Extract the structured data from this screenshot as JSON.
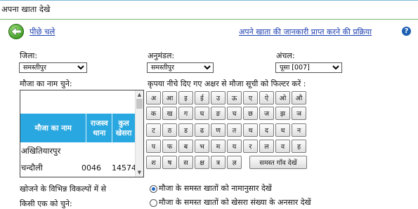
{
  "page": {
    "title": "अपना खाता देखे"
  },
  "nav": {
    "back_label": "पीछे चले",
    "process_link": "अपने खाता की जानकारी प्राप्त करने की प्रक्रिया",
    "help_icon": "help-icon"
  },
  "filters": {
    "district": {
      "label": "जिला:",
      "value": "समस्तीपुर"
    },
    "subdivision": {
      "label": "अनुमंडल:",
      "value": "समस्तीपुर"
    },
    "circle": {
      "label": "अंचल:",
      "value": "पूसा [007]"
    }
  },
  "mauza": {
    "label": "मौजा का नाम चुने:",
    "columns": [
      "मौजा का नाम",
      "राजस्व थाना",
      "कुल खेसरा"
    ],
    "rows": [
      {
        "name": "अखितियारपुर",
        "thana": "",
        "khesra": ""
      },
      {
        "name": "चन्दौली",
        "thana": "0046",
        "khesra": "14574"
      }
    ]
  },
  "keyboard": {
    "label": "कृपया नीचे दिए गए अक्षर से मौजा सूची को फिल्टर करें :",
    "rows": [
      [
        "अ",
        "आ",
        "इ",
        "ई",
        "उ",
        "ऊ",
        "ए",
        "ऐ",
        "ओ",
        "औ"
      ],
      [
        "क",
        "ख",
        "ग",
        "घ",
        "ङ",
        "च",
        "छ",
        "ज",
        "झ",
        "ञ"
      ],
      [
        "ट",
        "ठ",
        "ड",
        "ढ",
        "ण",
        "त",
        "थ",
        "द",
        "ध",
        "न"
      ],
      [
        "प",
        "फ",
        "ब",
        "भ",
        "म",
        "य",
        "र",
        "ल",
        "व",
        "ह"
      ],
      [
        "श",
        "ष",
        "स",
        "क्ष",
        "त्र",
        "ज्ञ"
      ]
    ],
    "all_label": "समस्त गाँव देखें"
  },
  "options": {
    "prompt_line1": "खोजने के विभिन्न विकल्पों में से",
    "prompt_line2": "किसी एक को चुने:",
    "choices": [
      {
        "label": "मौजा के समस्त खातों को नामानुसार देखें",
        "selected": true
      },
      {
        "label": "मौजा के समस्त खातों को खेसरा संख्या के अनसार देखें",
        "selected": false
      }
    ]
  }
}
